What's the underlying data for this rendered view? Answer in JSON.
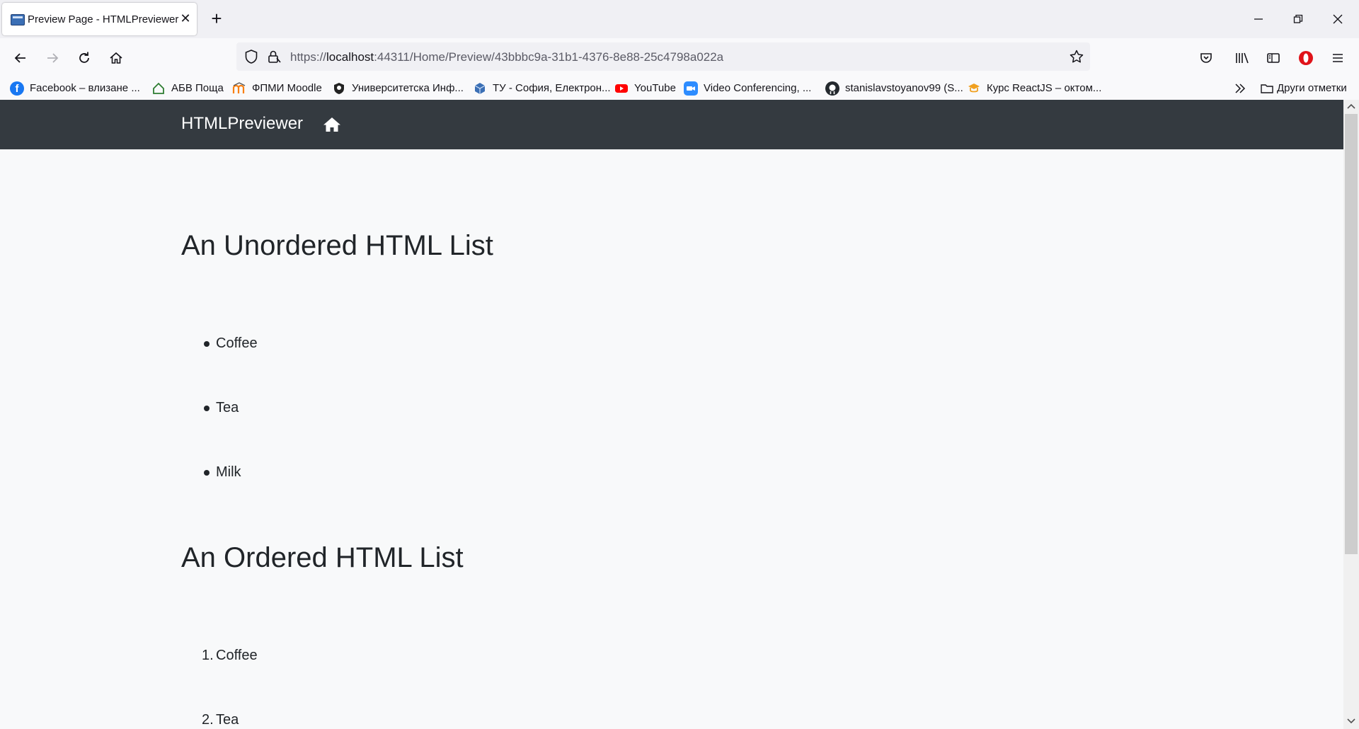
{
  "browser": {
    "tab_title": "Preview Page - HTMLPreviewer",
    "tab_close": "✕",
    "new_tab": "+",
    "url_prefix": "https://",
    "url_host": "localhost",
    "url_rest": ":44311/Home/Preview/43bbbc9a-31b1-4376-8e88-25c4798a022a",
    "bookmarks": [
      {
        "label": "Facebook – влизане ...",
        "icon": "facebook-icon",
        "color": "#1877f2"
      },
      {
        "label": "АБВ Поща",
        "icon": "house-icon",
        "color": "#2e7d32"
      },
      {
        "label": "ФПМИ Moodle",
        "icon": "moodle-icon",
        "color": "#f98012"
      },
      {
        "label": "Университетска Инф...",
        "icon": "crest-icon",
        "color": "#222222"
      },
      {
        "label": "ТУ - София, Електрон...",
        "icon": "cube-icon",
        "color": "#3b6fb5"
      },
      {
        "label": "YouTube",
        "icon": "youtube-icon",
        "color": "#ff0000"
      },
      {
        "label": "Video Conferencing, ...",
        "icon": "zoom-icon",
        "color": "#2d8cff"
      },
      {
        "label": "stanislavstoyanov99 (S...",
        "icon": "github-icon",
        "color": "#24292e"
      },
      {
        "label": "Курс ReactJS – октом...",
        "icon": "softuni-icon",
        "color": "#f0a020"
      }
    ],
    "other_bookmarks": "Други отметки"
  },
  "page": {
    "brand": "HTMLPreviewer",
    "unordered_heading": "An Unordered HTML List",
    "unordered_items": [
      "Coffee",
      "Tea",
      "Milk"
    ],
    "ordered_heading": "An Ordered HTML List",
    "ordered_items": [
      {
        "number": "1.",
        "text": "Coffee"
      },
      {
        "number": "2.",
        "text": "Tea"
      }
    ]
  },
  "colors": {
    "navbar": "#343a40",
    "page_bg": "#f8f9fa",
    "text": "#212529"
  }
}
